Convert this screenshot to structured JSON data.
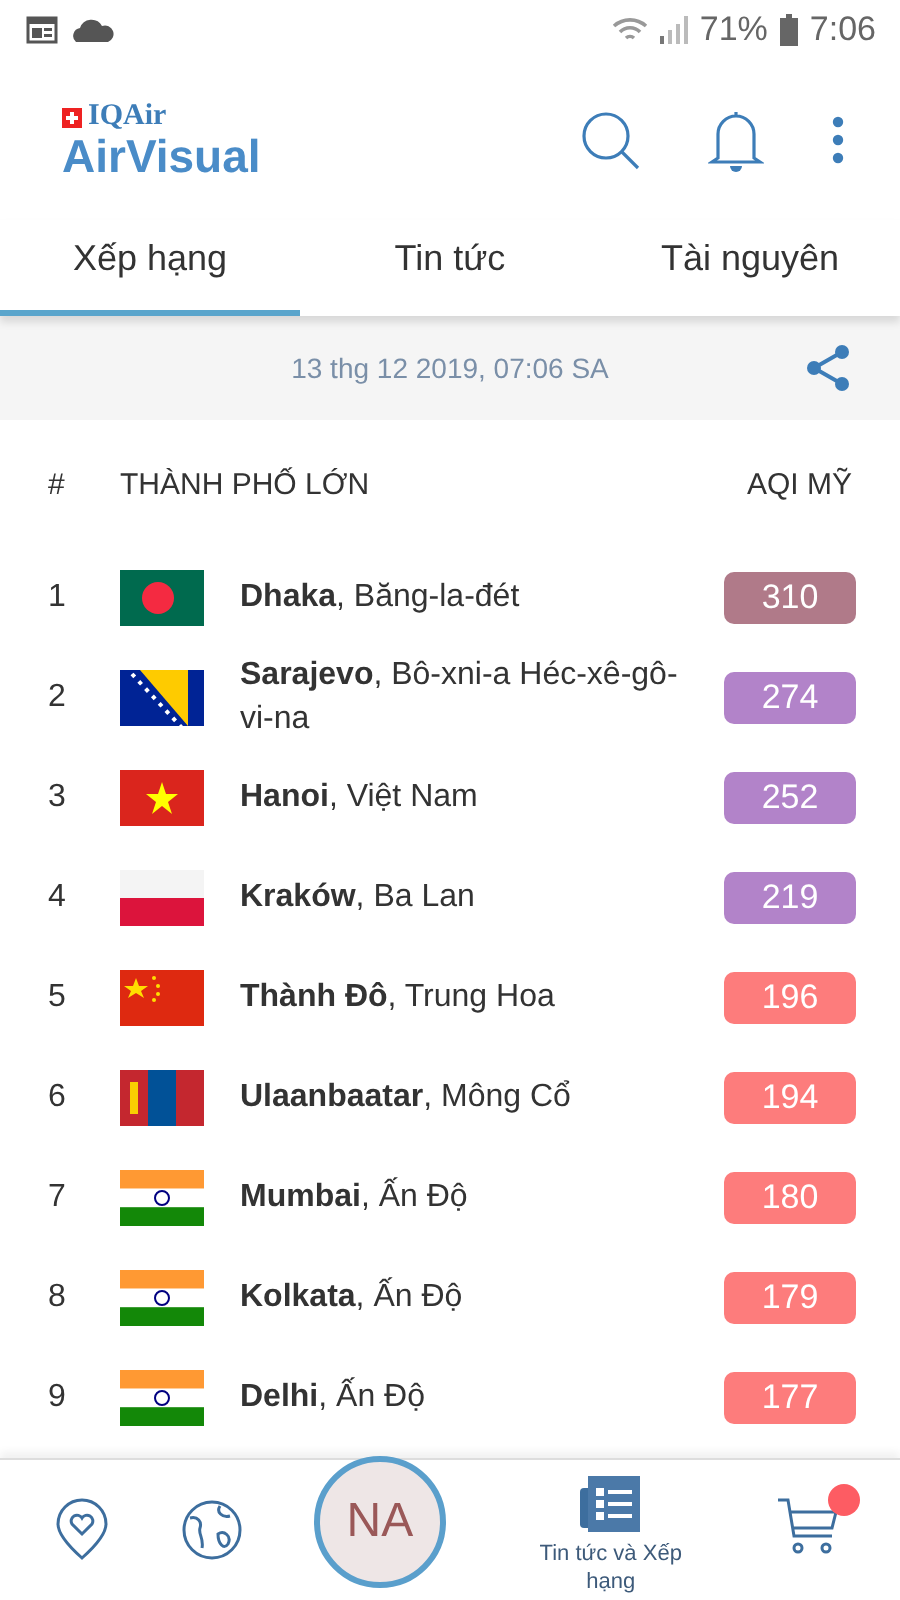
{
  "status_bar": {
    "battery": "71%",
    "time": "7:06"
  },
  "header": {
    "brand_top": "IQAir",
    "brand": "AirVisual"
  },
  "tabs": [
    {
      "label": "Xếp hạng",
      "selected": true
    },
    {
      "label": "Tin tức",
      "selected": false
    },
    {
      "label": "Tài nguyên",
      "selected": false
    }
  ],
  "date": "13 thg 12 2019, 07:06 SA",
  "table": {
    "columns": [
      "#",
      "THÀNH PHỐ LỚN",
      "AQI MỸ"
    ],
    "rows": [
      {
        "rank": "1",
        "kind": "bd",
        "city": "**Dhaka**, Băng-la-đét",
        "aqi": "310",
        "color": "#b07a89"
      },
      {
        "rank": "2",
        "kind": "ba",
        "city": "**Sarajevo**, Bô-xni-a Héc-xê-gô-vi-na",
        "aqi": "274",
        "color": "#b283c9"
      },
      {
        "rank": "3",
        "kind": "vn",
        "city": "**Hanoi**, Việt Nam",
        "aqi": "252",
        "color": "#b283c9"
      },
      {
        "rank": "4",
        "kind": "pl",
        "city": "**Kraków**, Ba Lan",
        "aqi": "219",
        "color": "#b283c9"
      },
      {
        "rank": "5",
        "kind": "cn",
        "city": "**Thành Đô**, Trung Hoa",
        "aqi": "196",
        "color": "#fd7c7c"
      },
      {
        "rank": "6",
        "kind": "mn",
        "city": "**Ulaanbaatar**, Mông Cổ",
        "aqi": "194",
        "color": "#fd7c7c"
      },
      {
        "rank": "7",
        "kind": "in",
        "city": "**Mumbai**, Ấn Độ",
        "aqi": "180",
        "color": "#fd7c7c"
      },
      {
        "rank": "8",
        "kind": "in",
        "city": "**Kolkata**, Ấn Độ",
        "aqi": "179",
        "color": "#fd7c7c"
      },
      {
        "rank": "9",
        "kind": "in",
        "city": "**Delhi**, Ấn Độ",
        "aqi": "177",
        "color": "#fd7c7c"
      }
    ]
  },
  "bottom_nav": {
    "avatar": "NA",
    "news_label": "Tin tức và Xếp hạng",
    "cart_badge": true
  }
}
